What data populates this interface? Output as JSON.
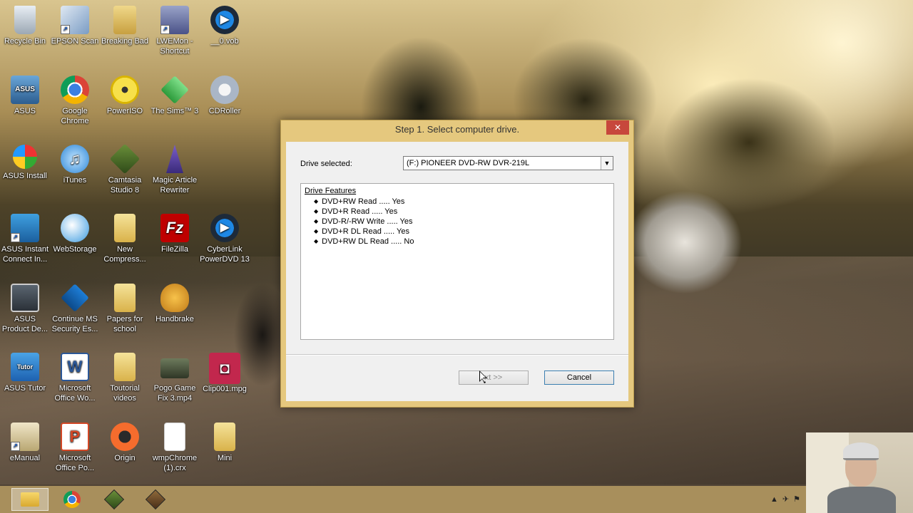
{
  "desktop": {
    "icons": [
      {
        "label": "Recycle Bin",
        "icon": "recycle-bin-icon"
      },
      {
        "label": "EPSON Scan",
        "icon": "scanner-icon"
      },
      {
        "label": "Breaking Bad",
        "icon": "folder-icon"
      },
      {
        "label": "LWEMon - Shortcut",
        "icon": "gamepad-icon"
      },
      {
        "label": "__0.vob",
        "icon": "play-icon"
      },
      {
        "label": "ASUS",
        "icon": "asus-icon"
      },
      {
        "label": "Google Chrome",
        "icon": "chrome-icon"
      },
      {
        "label": "PowerISO",
        "icon": "disc-icon"
      },
      {
        "label": "The Sims™ 3",
        "icon": "sims-icon"
      },
      {
        "label": "CDRoller",
        "icon": "cdroller-icon"
      },
      {
        "label": "ASUS Install",
        "icon": "install-icon"
      },
      {
        "label": "iTunes",
        "icon": "music-icon"
      },
      {
        "label": "Camtasia Studio 8",
        "icon": "camtasia-icon"
      },
      {
        "label": "Magic Article Rewriter",
        "icon": "wizard-icon"
      },
      {
        "label": "ASUS Instant Connect In...",
        "icon": "connect-icon"
      },
      {
        "label": "WebStorage",
        "icon": "cloud-icon"
      },
      {
        "label": "New Compress...",
        "icon": "zip-folder-icon"
      },
      {
        "label": "FileZilla",
        "icon": "filezilla-icon"
      },
      {
        "label": "CyberLink PowerDVD 13",
        "icon": "play-icon"
      },
      {
        "label": "ASUS Product De...",
        "icon": "monitor-icon"
      },
      {
        "label": "Continue MS Security Es...",
        "icon": "security-icon"
      },
      {
        "label": "Papers for school",
        "icon": "folder-icon"
      },
      {
        "label": "Handbrake",
        "icon": "handbrake-icon"
      },
      {
        "label": "ASUS Tutor",
        "icon": "tutor-icon"
      },
      {
        "label": "Microsoft Office Wo...",
        "icon": "word-icon"
      },
      {
        "label": "Toutorial videos",
        "icon": "folder-icon"
      },
      {
        "label": "Pogo Game Fix 3.mp4",
        "icon": "video-icon"
      },
      {
        "label": "Clip001.mpg",
        "icon": "media-icon"
      },
      {
        "label": "eManual",
        "icon": "manual-icon"
      },
      {
        "label": "Microsoft Office Po...",
        "icon": "powerpoint-icon"
      },
      {
        "label": "Origin",
        "icon": "origin-icon"
      },
      {
        "label": "wmpChrome (1).crx",
        "icon": "file-icon"
      },
      {
        "label": "Mini",
        "icon": "folder-icon"
      }
    ]
  },
  "dialog": {
    "title": "Step 1. Select computer drive.",
    "close_label": "✕",
    "drive_label": "Drive selected:",
    "drive_value": "(F:) PIONEER DVD-RW  DVR-219L",
    "features_title": "Drive Features",
    "features": [
      "DVD+RW Read ..... Yes",
      "DVD+R Read ..... Yes",
      "DVD-R/-RW Write ..... Yes",
      "DVD+R DL Read ..... Yes",
      "DVD+RW DL Read ..... No"
    ],
    "next_label": "xt >>",
    "cancel_label": "Cancel"
  },
  "taskbar": {
    "items": [
      {
        "icon": "file-explorer-icon",
        "active": true
      },
      {
        "icon": "chrome-icon",
        "active": false
      },
      {
        "icon": "camtasia-icon",
        "active": false
      },
      {
        "icon": "recorder-icon",
        "active": false
      }
    ]
  }
}
